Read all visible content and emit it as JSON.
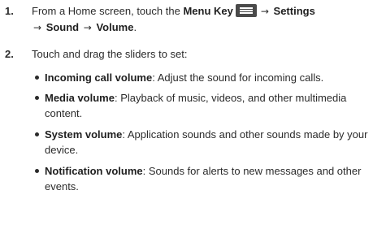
{
  "step1": {
    "number": "1.",
    "prefix": "From a Home screen, touch the",
    "menu_key_label": "Menu Key",
    "arrow": "→",
    "settings": "Settings",
    "sound": "Sound",
    "volume": "Volume",
    "period": "."
  },
  "step2": {
    "number": "2.",
    "text": "Touch and drag the sliders to set:"
  },
  "bullets": [
    {
      "term": "Incoming call volume",
      "desc": ": Adjust the sound for incoming calls."
    },
    {
      "term": "Media volume",
      "desc": ": Playback of music, videos, and other multimedia content."
    },
    {
      "term": "System volume",
      "desc": ": Application sounds and other sounds made by your device."
    },
    {
      "term": "Notification volume",
      "desc": ": Sounds for alerts to new messages and other events."
    }
  ],
  "icons": {
    "menu_key": "menu-key-icon",
    "bullet": "bullet-dot"
  },
  "colors": {
    "text": "#2b2b2b",
    "menu_key_bg": "#4a4a4a"
  }
}
